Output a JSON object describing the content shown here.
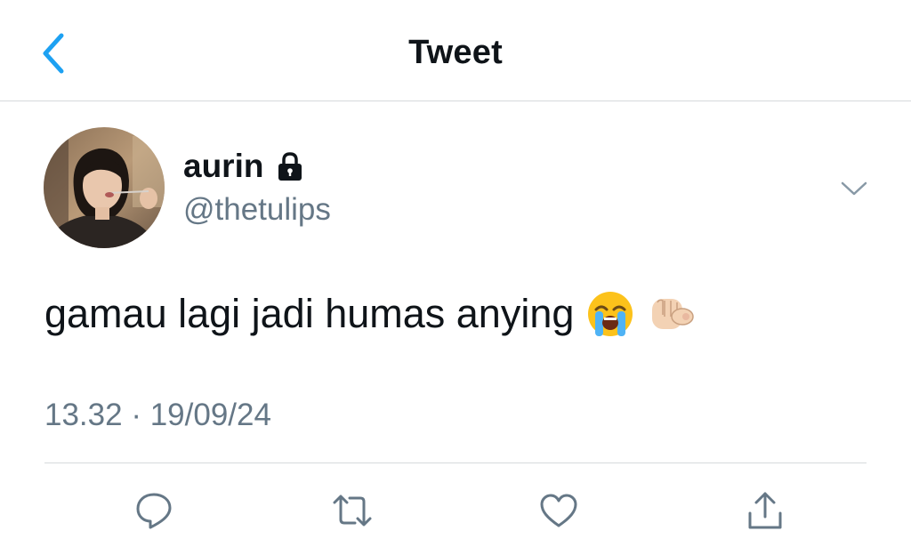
{
  "header": {
    "title": "Tweet",
    "back_icon": "chevron-left-icon"
  },
  "tweet": {
    "user": {
      "name": "aurin",
      "handle": "@thetulips",
      "protected_icon": "lock-icon"
    },
    "text": "gamau lagi jadi humas anying",
    "emojis": [
      "loudly-crying-face",
      "backhand-index-pointing-at-viewer"
    ],
    "time": "13.32",
    "separator": "·",
    "date": "19/09/24"
  },
  "actions": [
    {
      "name": "reply",
      "icon": "speech-bubble-icon"
    },
    {
      "name": "retweet",
      "icon": "retweet-icon"
    },
    {
      "name": "like",
      "icon": "heart-icon"
    },
    {
      "name": "share",
      "icon": "share-icon"
    }
  ],
  "colors": {
    "accent": "#1da1f2",
    "text_primary": "#0f1419",
    "text_secondary": "#657786",
    "divider": "#d6d9dc"
  }
}
